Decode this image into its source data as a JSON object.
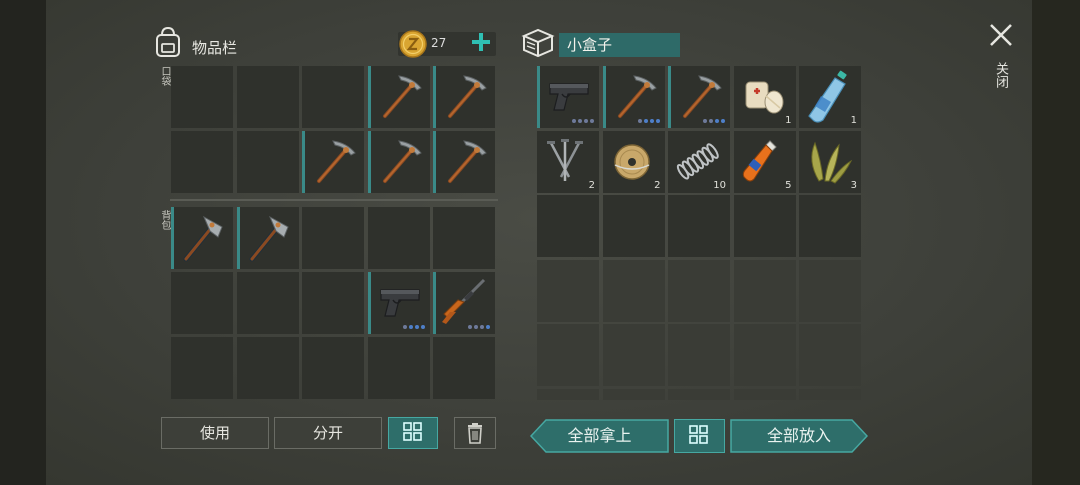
{
  "inventory": {
    "title": "物品栏",
    "coin_count": "27",
    "pocket_label": "口袋",
    "backpack_label": "背包",
    "pocket_items": [
      {
        "slot": 3,
        "icon": "pickaxe-icon",
        "accent": true
      },
      {
        "slot": 4,
        "icon": "pickaxe-icon",
        "accent": true
      },
      {
        "slot": 7,
        "icon": "pickaxe-icon",
        "accent": true
      },
      {
        "slot": 8,
        "icon": "pickaxe-icon",
        "accent": true
      },
      {
        "slot": 9,
        "icon": "pickaxe-icon",
        "accent": true
      }
    ],
    "backpack_items": [
      {
        "slot": 0,
        "icon": "axe-icon",
        "accent": true
      },
      {
        "slot": 1,
        "icon": "axe-icon",
        "accent": true
      },
      {
        "slot": 8,
        "icon": "pistol-icon",
        "accent": true,
        "durability": 3
      },
      {
        "slot": 9,
        "icon": "rifle-icon",
        "accent": true,
        "durability": 1
      }
    ]
  },
  "container": {
    "name": "小盒子",
    "items": [
      {
        "slot": 0,
        "icon": "pistol-icon",
        "accent": true,
        "durability": 0
      },
      {
        "slot": 1,
        "icon": "pickaxe-icon",
        "accent": true,
        "durability": 3
      },
      {
        "slot": 2,
        "icon": "pickaxe-icon",
        "accent": true,
        "durability": 2
      },
      {
        "slot": 3,
        "icon": "bandage-icon",
        "qty": "1"
      },
      {
        "slot": 4,
        "icon": "water-bottle-icon",
        "qty": "1"
      },
      {
        "slot": 5,
        "icon": "nails-icon",
        "qty": "2"
      },
      {
        "slot": 6,
        "icon": "wire-spool-icon",
        "qty": "2"
      },
      {
        "slot": 7,
        "icon": "spring-icon",
        "qty": "10"
      },
      {
        "slot": 8,
        "icon": "glue-icon",
        "qty": "5"
      },
      {
        "slot": 9,
        "icon": "plant-fiber-icon",
        "qty": "3"
      }
    ]
  },
  "buttons": {
    "use": "使用",
    "split": "分开",
    "take_all": "全部拿上",
    "put_all": "全部放入"
  },
  "close_label": "关闭",
  "colors": {
    "accent": "#2e6e6a",
    "slot": "#2f312c",
    "durability_on": "#4e7fc8"
  }
}
